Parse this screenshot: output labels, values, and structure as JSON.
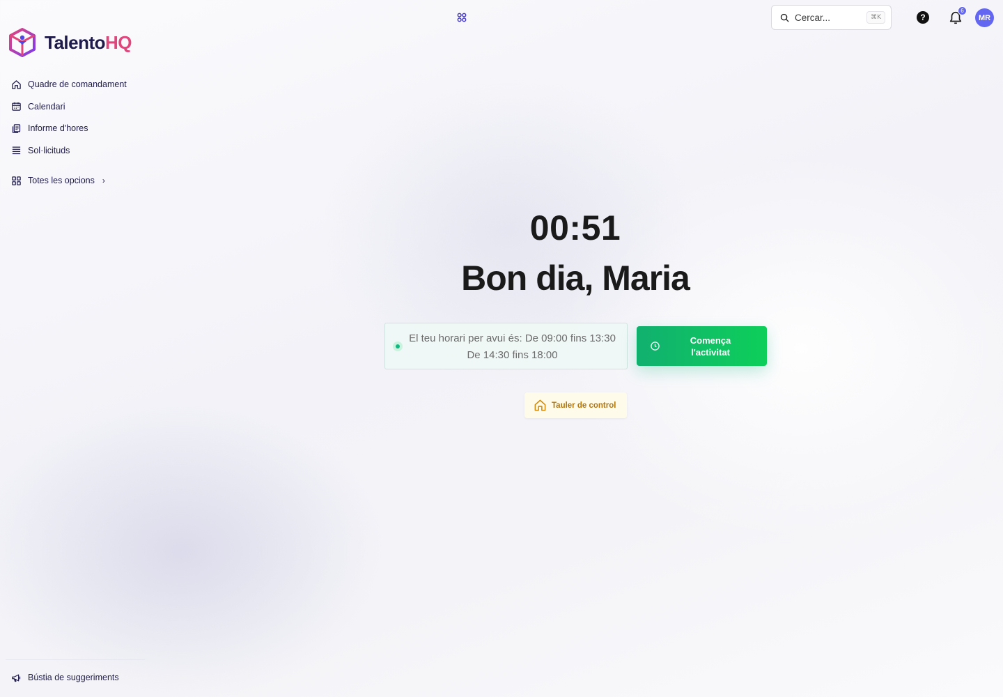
{
  "brand": {
    "name_part1": "Talento",
    "name_part2": "HQ",
    "primary_color": "#1e1b4b",
    "accent_color": "#e0457b"
  },
  "sidebar": {
    "items": [
      {
        "label": "Quadre de comandament",
        "icon": "home-icon"
      },
      {
        "label": "Calendari",
        "icon": "calendar-icon"
      },
      {
        "label": "Informe d'hores",
        "icon": "report-icon"
      },
      {
        "label": "Sol·licituds",
        "icon": "list-icon"
      }
    ],
    "all_options": {
      "label": "Totes les opcions",
      "icon": "grid-icon"
    },
    "feedback": {
      "label": "Bústia de suggeriments",
      "icon": "megaphone-icon"
    }
  },
  "topbar": {
    "search_placeholder": "Cercar...",
    "search_shortcut": "⌘K",
    "help_label": "?",
    "notifications_count": "6",
    "avatar_initials": "MR",
    "avatar_color": "#6366f1"
  },
  "main": {
    "clock": "00:51",
    "greeting": "Bon dia, Maria",
    "schedule_line1": "El teu horari per avui és: De 09:00 fins 13:30",
    "schedule_line2": "De 14:30 fins 18:00",
    "start_button": "Comença l'activitat",
    "dashboard_button": "Tauler de control",
    "start_color": "#10b981",
    "dashboard_color": "#b4760a"
  }
}
